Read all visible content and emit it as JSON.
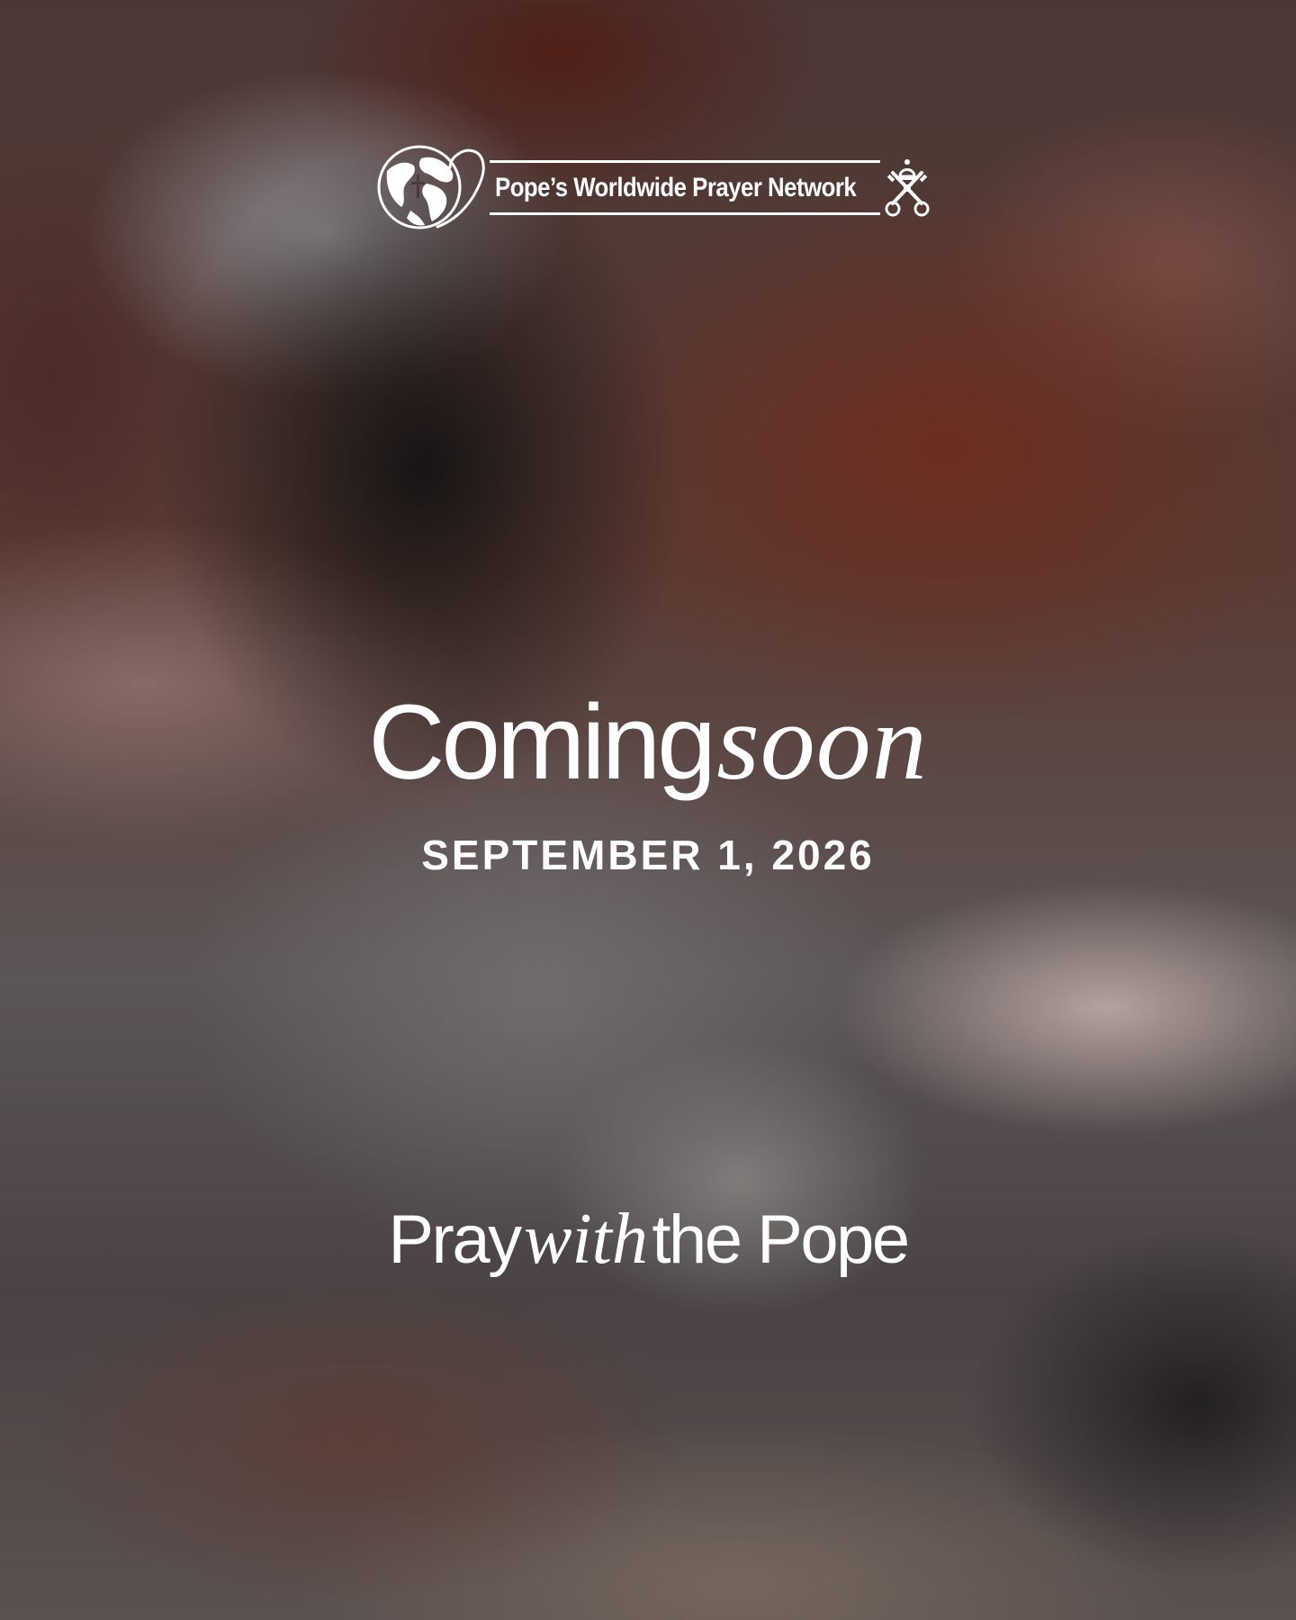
{
  "brand": {
    "name": "Pope’s Worldwide Prayer Network",
    "globe_icon": "globe-heart-icon",
    "keys_icon": "papal-keys-icon"
  },
  "hero": {
    "headline_sans": "Coming",
    "headline_serif": "soon",
    "date": "SEPTEMBER 1, 2026"
  },
  "tagline": {
    "part1": "Pray",
    "part2": "with",
    "part3": "the Pope"
  },
  "colors": {
    "text": "#ffffff",
    "background_warm": "#5a3b33",
    "background_cool": "#5c5556"
  }
}
